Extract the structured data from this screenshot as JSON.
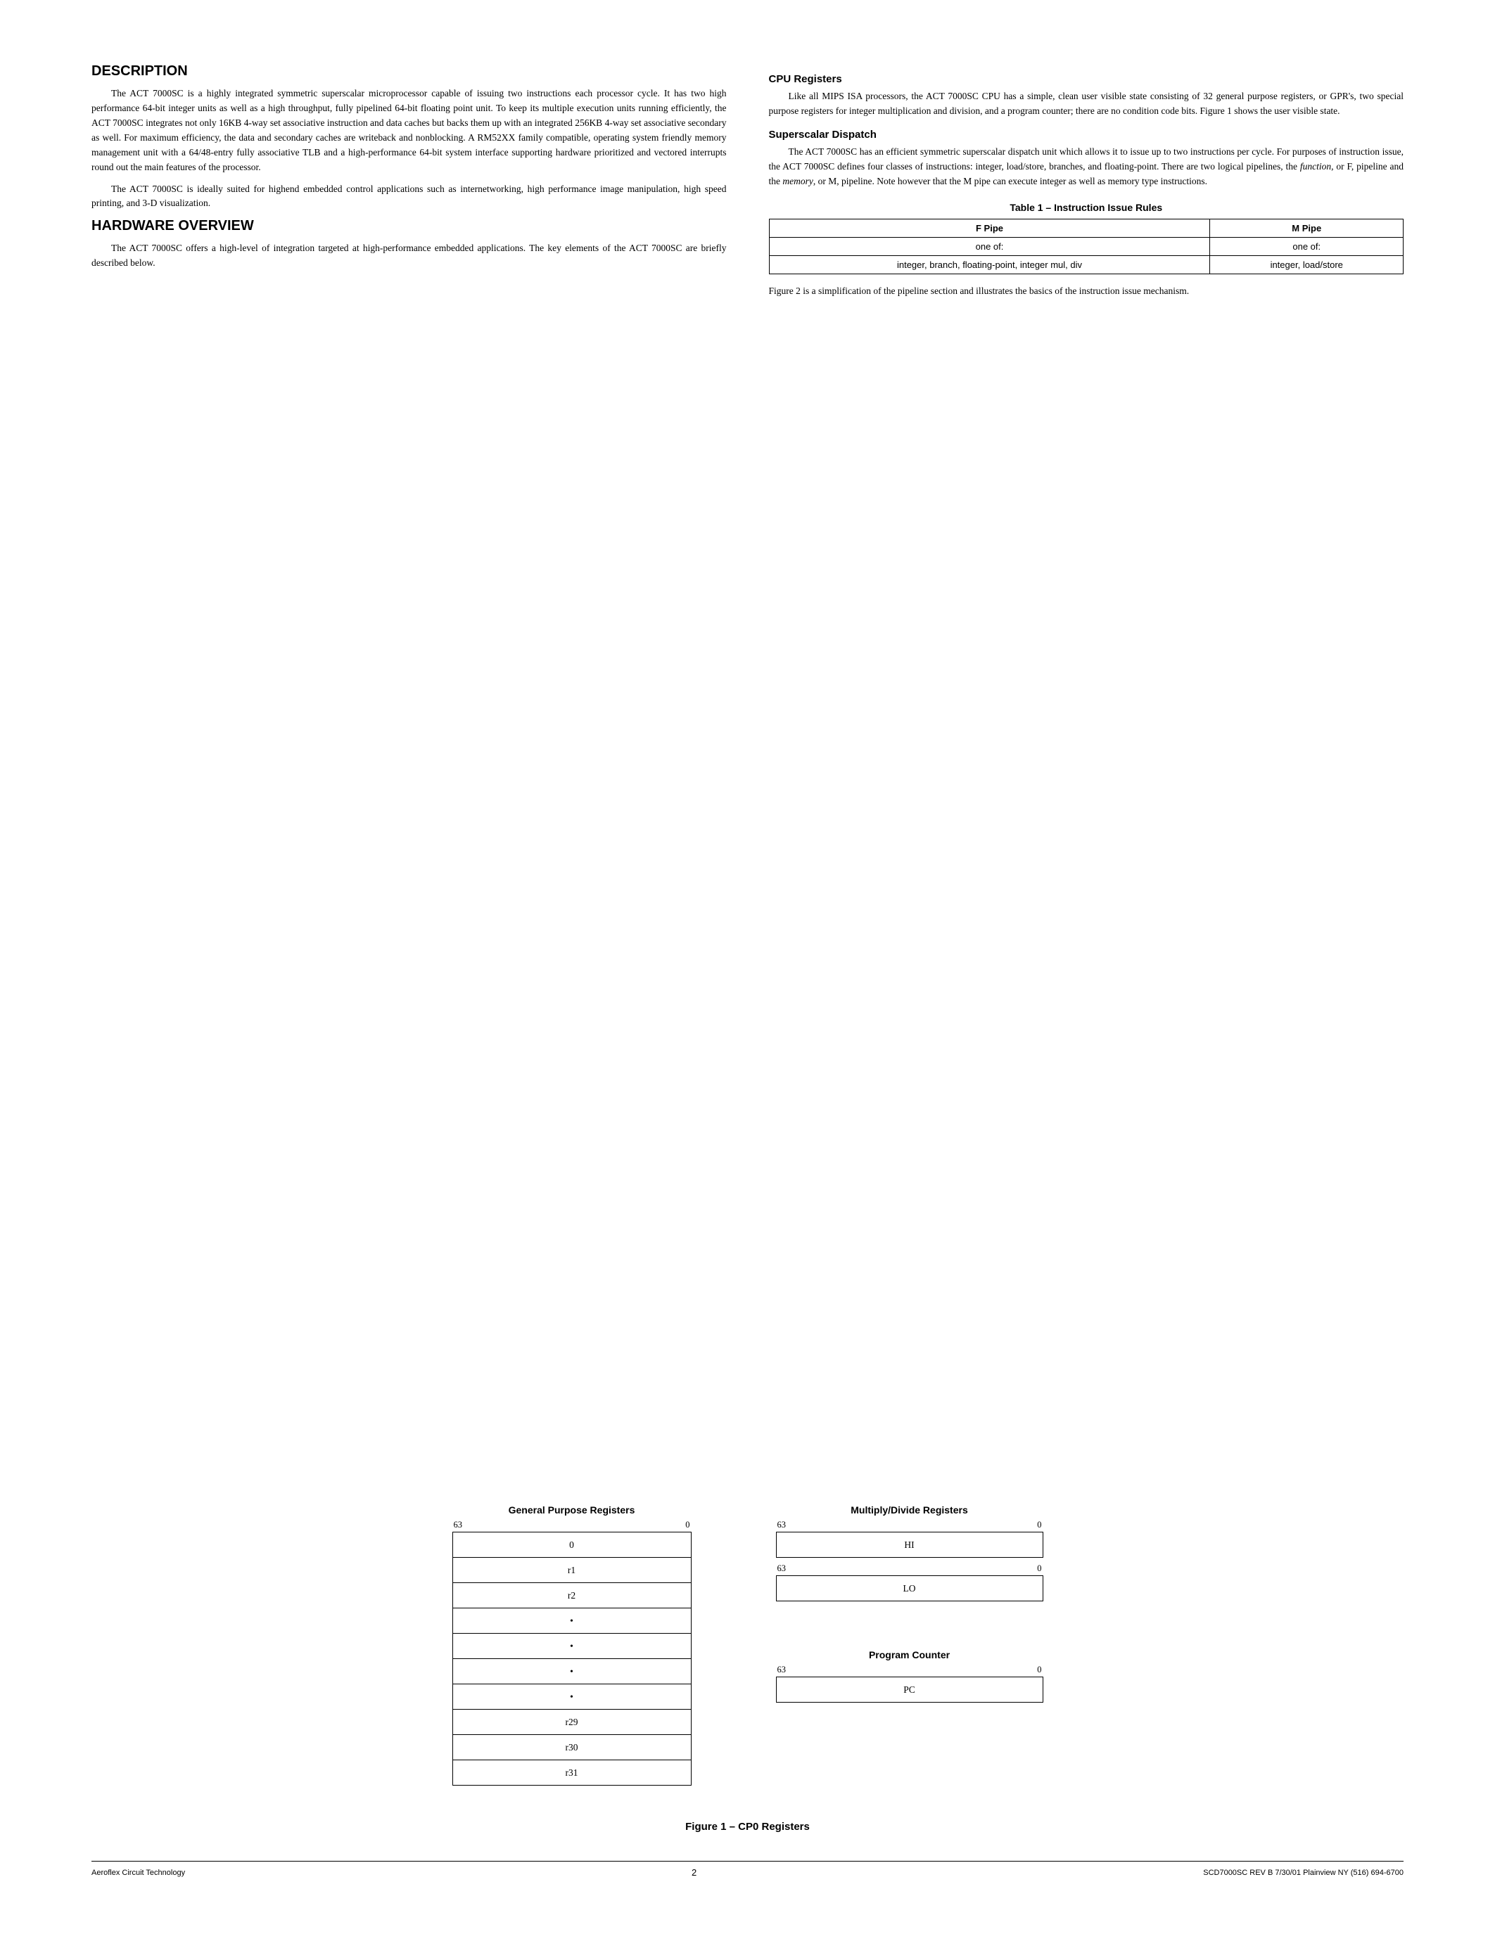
{
  "page": {
    "footer": {
      "left": "Aeroflex Circuit Technology",
      "center": "2",
      "right": "SCD7000SC REV B  7/30/01  Plainview NY (516) 694-6700"
    }
  },
  "description": {
    "title": "DESCRIPTION",
    "paragraphs": [
      "The ACT 7000SC is a highly integrated symmetric superscalar microprocessor capable of issuing two instructions each processor cycle. It has two high performance 64-bit integer units as well as a high throughput, fully pipelined 64-bit floating point unit. To keep its multiple execution units running efficiently, the ACT 7000SC integrates not only 16KB 4-way set associative instruction and data caches but backs them up with an integrated 256KB 4-way set associative secondary as well. For maximum efficiency, the data and secondary caches are writeback and nonblocking. A RM52XX family compatible, operating system friendly memory management unit with a 64/48-entry fully associative TLB and a high-performance 64-bit system interface supporting hardware prioritized and vectored interrupts round out the main features of the processor.",
      "The ACT 7000SC is ideally suited for highend embedded control applications such as internetworking, high performance image manipulation, high speed printing, and 3-D visualization."
    ]
  },
  "hardware": {
    "title": "HARDWARE OVERVIEW",
    "paragraph": "The ACT 7000SC offers a high-level of integration targeted at high-performance embedded applications. The key elements of the ACT 7000SC are briefly described below."
  },
  "cpu_registers": {
    "title": "CPU Registers",
    "paragraph": "Like all MIPS ISA processors, the ACT 7000SC CPU has a simple, clean user visible state consisting of 32 general purpose registers, or GPR's, two special purpose registers for integer multiplication and division, and a program counter; there are no condition code bits. Figure 1 shows the user visible state."
  },
  "superscalar": {
    "title": "Superscalar Dispatch",
    "paragraph": "The ACT 7000SC has an efficient symmetric superscalar dispatch unit which allows it to issue up to two instructions per cycle. For purposes of instruction issue, the ACT 7000SC defines four classes of instructions: integer, load/store, branches, and floating-point. There are two logical pipelines, the function, or F, pipeline and the memory, or M, pipeline. Note however that the M pipe can execute integer as well as memory type instructions."
  },
  "table": {
    "title": "Table 1 – Instruction Issue Rules",
    "headers": [
      "F Pipe",
      "M Pipe"
    ],
    "row1": [
      "one of:",
      "one of:"
    ],
    "row2": [
      "integer, branch, floating-point, integer mul, div",
      "integer, load/store"
    ]
  },
  "figure_note": "Figure 2 is a simplification of the pipeline section and illustrates the basics of the instruction issue mechanism.",
  "gpr": {
    "title": "General Purpose Registers",
    "bit_high": "63",
    "bit_low": "0",
    "rows": [
      "0",
      "r1",
      "r2",
      "•",
      "•",
      "•",
      "•",
      "r29",
      "r30",
      "r31"
    ]
  },
  "multiply_divide": {
    "title": "Multiply/Divide Registers",
    "bit_high": "63",
    "bit_low": "0",
    "hi_label": "HI",
    "lo_label": "LO"
  },
  "program_counter": {
    "title": "Program Counter",
    "bit_high": "63",
    "bit_low": "0",
    "pc_label": "PC"
  },
  "figure_caption": "Figure 1 – CP0 Registers"
}
